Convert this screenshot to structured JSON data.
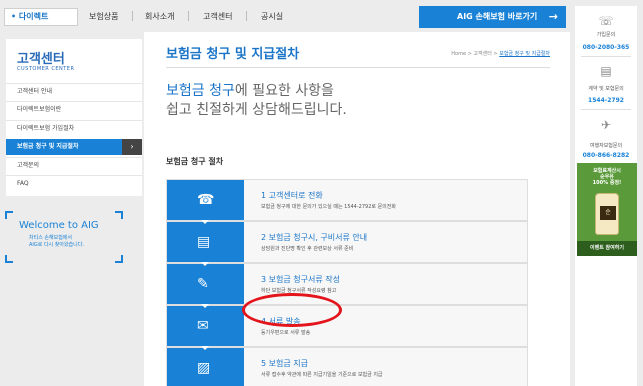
{
  "top_nav": {
    "home_label": "• 다이렉트",
    "items": [
      "보험상품",
      "회사소개",
      "고객센터",
      "공시실"
    ],
    "aig_button_label": "AIG 손해보험 바로가기",
    "aig_button_arrow": "→"
  },
  "sidebar": {
    "title": "고객센터",
    "subtitle": "CUSTOMER CENTER",
    "items": [
      {
        "label": "고객센터 안내"
      },
      {
        "label": "다이렉트보험이란"
      },
      {
        "label": "다이렉트보험 가입절차"
      },
      {
        "label": "보험금 청구 및 지급절차"
      },
      {
        "label": "고객문의"
      },
      {
        "label": "FAQ"
      }
    ],
    "active_index": 3,
    "active_arrow": "›"
  },
  "welcome": {
    "title": "Welcome to AIG",
    "line1": "차티스 손해보험에서",
    "line2": "AIG로 다시 찾아왔습니다."
  },
  "main": {
    "title": "보험금 청구 및 지급절차",
    "breadcrumb": {
      "home": "Home",
      "sep": ">",
      "parent": "고객센터",
      "current": "보험금 청구 및 지급절차"
    },
    "lead_highlight": "보험금 청구",
    "lead_rest": "에 필요한 사항을",
    "lead_line2": "쉽고 친절하게 상담해드립니다.",
    "section_title": "보험금 청구 절차",
    "steps": [
      {
        "icon": "phone-icon",
        "title": "1 고객센터로 전화",
        "desc": "보험금 청구에 대한 문의가 있으실 때는 1544-2792로 문의전화"
      },
      {
        "icon": "document-icon",
        "title": "2 보험금 청구시, 구비서류 안내",
        "desc": "상담원과 진단명 확인 후 관련보상 서류 준비"
      },
      {
        "icon": "pen-icon",
        "title": "3 보험금 청구서류 작성",
        "desc": "하단 보험금 청구서류 작성요령 참고"
      },
      {
        "icon": "envelope-icon",
        "title": "4 서류 발송",
        "desc": "등기우편으로 서류 발송"
      },
      {
        "icon": "gift-icon",
        "title": "5 보험금 지급",
        "desc": "서류 접수후 약관에 따른 지급기일을 기준으로 보험금 지급"
      }
    ]
  },
  "right_rail": {
    "entries": [
      {
        "icon": "phone-signal-icon",
        "label": "가입문의",
        "number": "080-2080-365"
      },
      {
        "icon": "claim-icon",
        "label": "계약 및 보험문의",
        "number": "1544-2792"
      },
      {
        "icon": "airplane-icon",
        "label": "여행자보험문의",
        "number": "080-866-8282"
      }
    ],
    "promo": {
      "line1": "보험료계산시",
      "line2": "순우유",
      "line3": "100% 증정!",
      "bottle_label": "순",
      "button": "이벤트 참여하기"
    }
  },
  "colors": {
    "accent": "#1a82d6",
    "highlight_circle": "#e3141b",
    "promo": "#5a9a3a"
  }
}
